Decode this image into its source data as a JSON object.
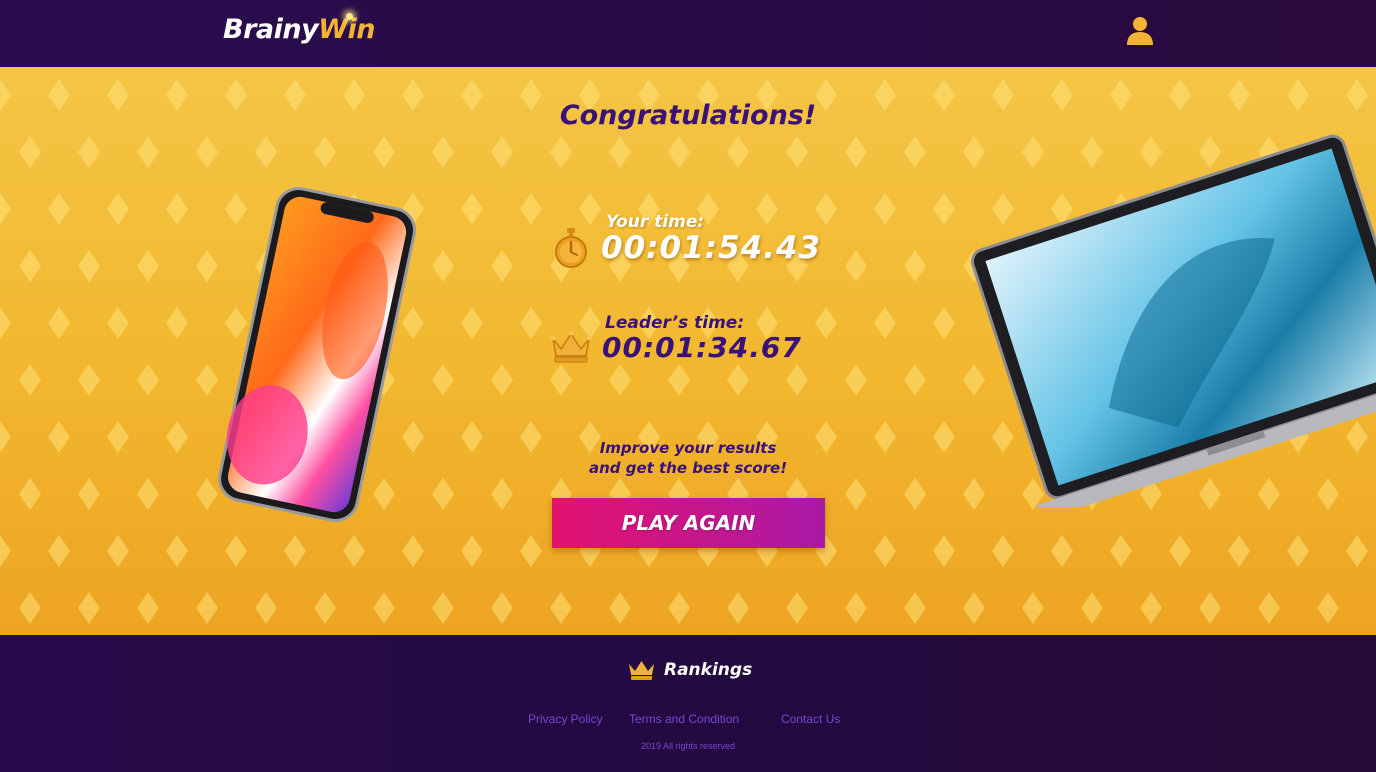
{
  "header": {
    "logo_part1": "Brainy",
    "logo_part2": "Win",
    "user_icon": "user-icon"
  },
  "main": {
    "title": "Congratulations!",
    "your_time_label": "Your time:",
    "your_time_value": "00:01:54.43",
    "leader_time_label": "Leader’s time:",
    "leader_time_value": "00:01:34.67",
    "improve_line1": "Improve your results",
    "improve_line2": "and get the best score!",
    "play_again_label": "PLAY AGAIN",
    "icons": [
      "stopwatch-icon",
      "crown-icon",
      "smartphone-image",
      "laptop-image"
    ]
  },
  "footer": {
    "rankings_label": "Rankings",
    "links": [
      "Privacy Policy",
      "Terms and Condition",
      "Contact Us"
    ],
    "copyright": "2019 All rights reserved"
  },
  "colors": {
    "header_bg": "#2a0d4f",
    "main_bg": "#f2b830",
    "title_purple": "#3a1178",
    "button_pink": "#e4126e",
    "button_purple": "#a919a6",
    "link_purple": "#7a45d6",
    "accent_gold": "#f3b436"
  }
}
